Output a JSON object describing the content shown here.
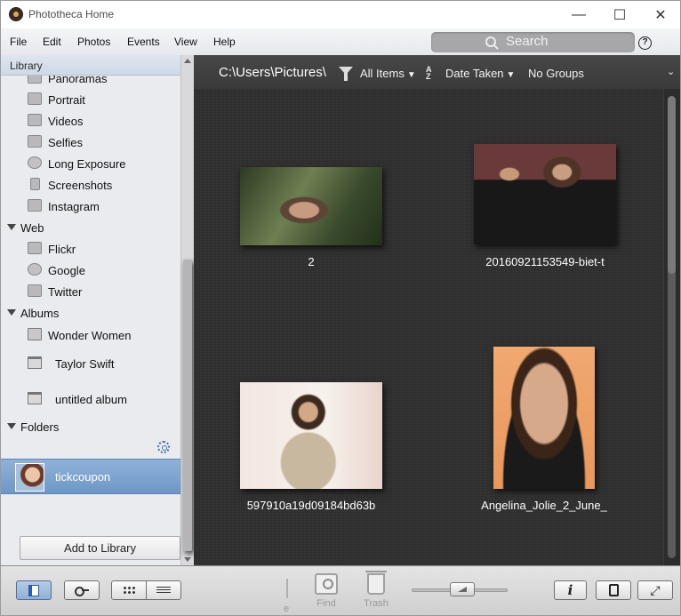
{
  "window": {
    "title": "Phototheca Home",
    "controls": {
      "minimize": "—",
      "maximize": "☐",
      "close": "✕"
    }
  },
  "menu": {
    "items": [
      "File",
      "Edit",
      "Photos",
      "Events",
      "View",
      "Help"
    ],
    "search_label": "Search",
    "help_label": "?"
  },
  "sidebar": {
    "header": "Library",
    "library_items": [
      {
        "label": "Panoramas",
        "icon": "panorama-icon"
      },
      {
        "label": "Portrait",
        "icon": "cube-icon"
      },
      {
        "label": "Videos",
        "icon": "video-camera-icon"
      },
      {
        "label": "Selfies",
        "icon": "person-icon"
      },
      {
        "label": "Long Exposure",
        "icon": "circle-icon"
      },
      {
        "label": "Screenshots",
        "icon": "phone-icon"
      },
      {
        "label": "Instagram",
        "icon": "instagram-icon"
      }
    ],
    "web_section": "Web",
    "web_items": [
      {
        "label": "Flickr",
        "icon": "flickr-icon"
      },
      {
        "label": "Google",
        "icon": "google-icon"
      },
      {
        "label": "Twitter",
        "icon": "twitter-icon"
      }
    ],
    "albums_section": "Albums",
    "album_items": [
      {
        "label": "Wonder Women",
        "icon": "folder-icon"
      },
      {
        "label": "Taylor Swift",
        "icon": "album-icon"
      },
      {
        "label": "untitled album",
        "icon": "album-icon"
      }
    ],
    "folders_section": "Folders",
    "folder_items": [
      {
        "label": "tickcoupon",
        "selected": true
      }
    ],
    "add_button": "Add to Library"
  },
  "toolbar": {
    "path": "C:\\Users\\Pictures\\",
    "filter": "All Items",
    "sort": "Date Taken",
    "sort_icon_top": "A",
    "sort_icon_bottom": "Z",
    "groups": "No Groups",
    "more": "⌄"
  },
  "photos": [
    {
      "caption": "2"
    },
    {
      "caption": "20160921153549-biet-t"
    },
    {
      "caption": "597910a19d09184bd63b"
    },
    {
      "caption": "Angelina_Jolie_2_June_"
    }
  ],
  "bottombar": {
    "edge_label": "e",
    "find_label": "Find",
    "trash_label": "Trash",
    "info_label": "i",
    "fullscreen_label": "⤢",
    "zoom_level": 0.5
  },
  "colors": {
    "content_bg": "#2e2e2e",
    "toolbar_bg": "#3f3f3f",
    "selection": "#7ea3cf",
    "sidebar_bg": "#e9ebef"
  }
}
